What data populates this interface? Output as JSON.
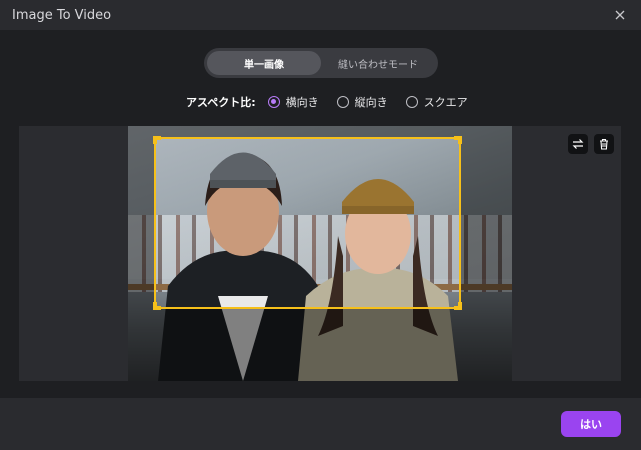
{
  "window": {
    "title": "Image To Video",
    "close_icon": "close-icon"
  },
  "mode": {
    "options": [
      "単一画像",
      "縫い合わせモード"
    ],
    "selected": "単一画像"
  },
  "aspect": {
    "label": "アスペクト比:",
    "options": [
      "横向き",
      "縦向き",
      "スクエア"
    ],
    "selected": "横向き"
  },
  "tools": {
    "swap_icon": "swap-icon",
    "delete_icon": "trash-icon"
  },
  "footer": {
    "confirm_label": "はい"
  },
  "colors": {
    "accent": "#9a44f0",
    "radio": "#b77cf7",
    "crop": "#f6c01a"
  }
}
